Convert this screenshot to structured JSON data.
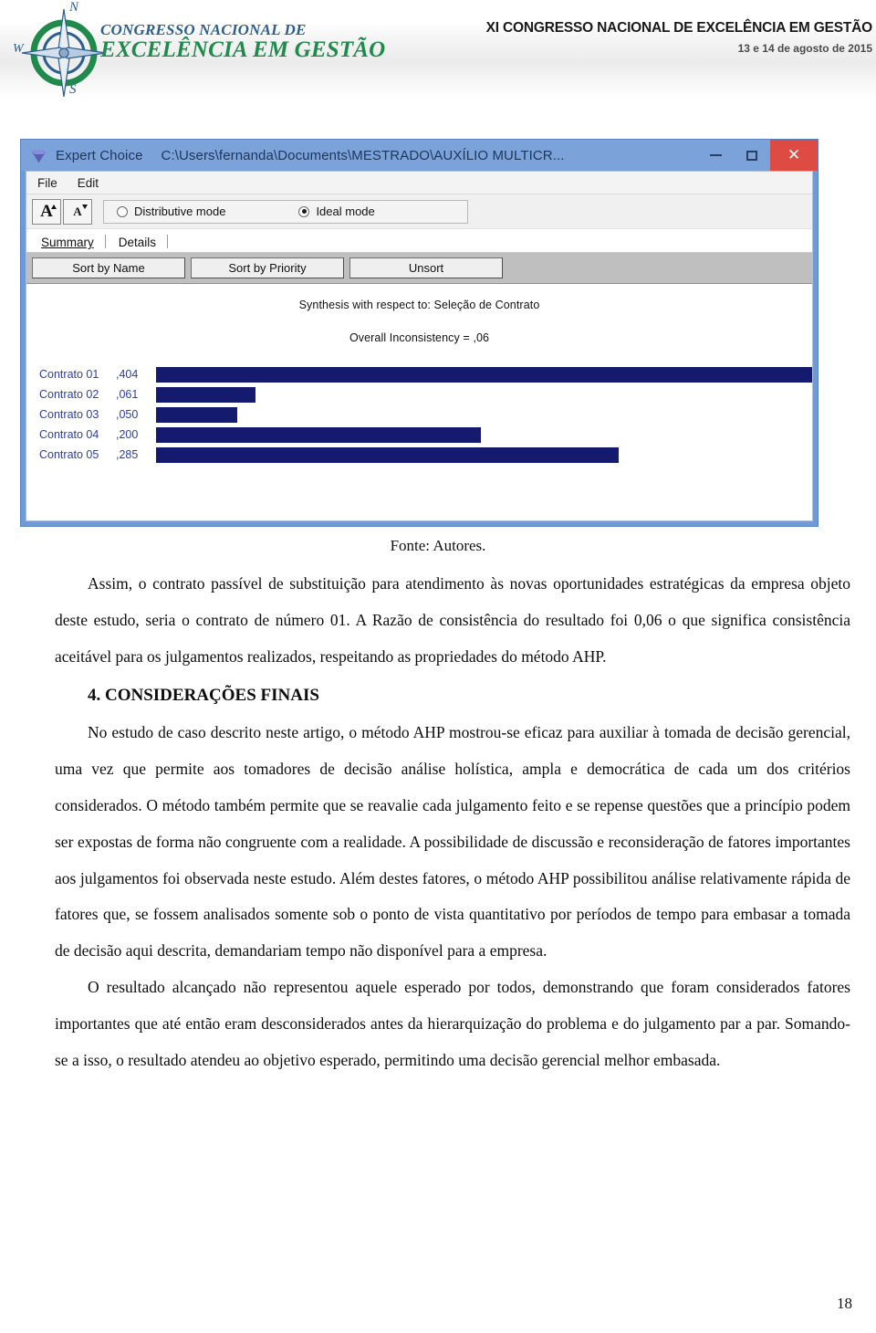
{
  "header": {
    "logo_line1": "CONGRESSO NACIONAL DE",
    "logo_line2": "EXCELÊNCIA EM GESTÃO",
    "compass_n": "N",
    "compass_s": "S",
    "compass_w": "W",
    "congress_title": "XI CONGRESSO NACIONAL DE EXCELÊNCIA EM GESTÃO",
    "congress_date": "13 e 14 de agosto de 2015"
  },
  "figure": {
    "window": {
      "app_name": "Expert Choice",
      "file_path": "C:\\Users\\fernanda\\Documents\\MESTRADO\\AUXÍLIO MULTICR...",
      "minimize_label": "",
      "maximize_label": "",
      "close_label": "✕",
      "titlebar_color": "#7ba3da",
      "close_color": "#dd4b42"
    },
    "menu": {
      "file": "File",
      "edit": "Edit"
    },
    "toolbar": {
      "increase_font_label": "A",
      "decrease_font_label": "A",
      "distributive_mode": "Distributive mode",
      "ideal_mode": "Ideal mode",
      "selected_mode": "Ideal mode"
    },
    "tabs": [
      {
        "label": "Summary",
        "selected": true
      },
      {
        "label": "Details",
        "selected": false
      }
    ],
    "sort_buttons": [
      {
        "label": "Sort by Name"
      },
      {
        "label": "Sort by Priority"
      },
      {
        "label": "Unsort"
      }
    ]
  },
  "chart_data": {
    "type": "bar",
    "orientation": "horizontal",
    "title": "Synthesis with respect to: Seleção de Contrato",
    "subtitle": "Overall Inconsistency = ,06",
    "overall_inconsistency": 0.06,
    "categories": [
      "Contrato 01",
      "Contrato 02",
      "Contrato 03",
      "Contrato 04",
      "Contrato 05"
    ],
    "values": [
      0.404,
      0.061,
      0.05,
      0.2,
      0.285
    ],
    "value_labels": [
      ",404",
      ",061",
      ",050",
      ",200",
      ",285"
    ],
    "xlabel": "",
    "ylabel": "",
    "xlim": [
      0,
      0.404
    ],
    "grid": false,
    "legend": false,
    "bar_color": "#141a6e",
    "label_color": "#2b3ea8"
  },
  "caption": "Fonte: Autores.",
  "body": {
    "para1": "Assim, o contrato passível de substituição para atendimento às novas oportunidades estratégicas da empresa objeto deste estudo, seria o contrato de número 01. A Razão de consistência do resultado foi 0,06 o que significa consistência aceitável para os julgamentos realizados, respeitando as propriedades do método AHP.",
    "section_heading": "4. CONSIDERAÇÕES FINAIS",
    "para2": "No estudo de caso descrito neste artigo, o método AHP mostrou-se eficaz para auxiliar à tomada de decisão gerencial, uma vez que permite aos tomadores de decisão análise holística, ampla e democrática de cada um dos critérios considerados. O método também permite que se reavalie cada julgamento feito e se repense questões que a princípio podem ser expostas de forma não congruente com a realidade. A possibilidade de discussão e reconsideração de fatores importantes aos julgamentos foi observada neste estudo. Além destes fatores, o método AHP possibilitou análise relativamente rápida de fatores que, se fossem analisados somente sob o ponto de vista quantitativo por períodos de tempo para embasar a tomada de decisão aqui descrita, demandariam tempo não disponível para a empresa.",
    "para3": "O resultado alcançado não representou aquele esperado por todos, demonstrando que foram considerados fatores importantes que até então eram desconsiderados antes da hierarquização do problema e do julgamento par a par. Somando-se a isso, o resultado atendeu ao objetivo esperado, permitindo uma decisão gerencial melhor embasada."
  },
  "page_number": "18"
}
